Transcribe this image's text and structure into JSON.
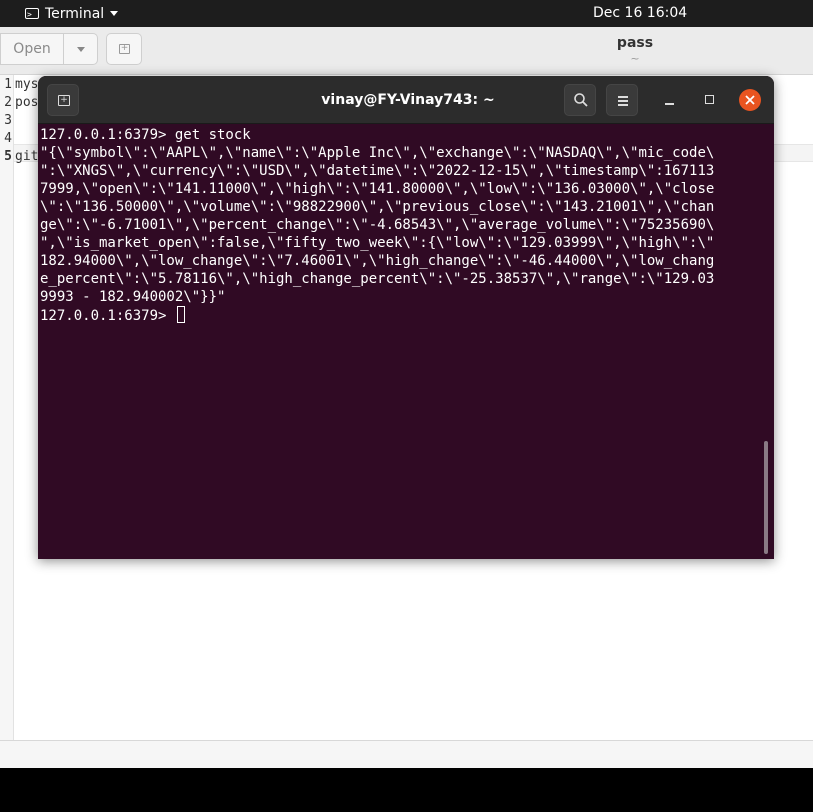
{
  "top_bar": {
    "app_name": "Terminal",
    "clock": "Dec 16  16:04"
  },
  "gedit": {
    "open_label": "Open",
    "title": "pass",
    "subtitle": "~",
    "line_numbers": [
      "1",
      "2",
      "3",
      "4",
      "5"
    ],
    "lines": [
      "mys",
      "pos",
      "",
      "",
      "git"
    ]
  },
  "terminal": {
    "title": "vinay@FY-Vinay743: ~",
    "lines": [
      "127.0.0.1:6379> get stock",
      "\"{\\\"symbol\\\":\\\"AAPL\\\",\\\"name\\\":\\\"Apple Inc\\\",\\\"exchange\\\":\\\"NASDAQ\\\",\\\"mic_code\\",
      "\":\\\"XNGS\\\",\\\"currency\\\":\\\"USD\\\",\\\"datetime\\\":\\\"2022-12-15\\\",\\\"timestamp\\\":167113",
      "7999,\\\"open\\\":\\\"141.11000\\\",\\\"high\\\":\\\"141.80000\\\",\\\"low\\\":\\\"136.03000\\\",\\\"close",
      "\\\":\\\"136.50000\\\",\\\"volume\\\":\\\"98822900\\\",\\\"previous_close\\\":\\\"143.21001\\\",\\\"chan",
      "ge\\\":\\\"-6.71001\\\",\\\"percent_change\\\":\\\"-4.68543\\\",\\\"average_volume\\\":\\\"75235690\\",
      "\",\\\"is_market_open\\\":false,\\\"fifty_two_week\\\":{\\\"low\\\":\\\"129.03999\\\",\\\"high\\\":\\\"",
      "182.94000\\\",\\\"low_change\\\":\\\"7.46001\\\",\\\"high_change\\\":\\\"-46.44000\\\",\\\"low_chang",
      "e_percent\\\":\\\"5.78116\\\",\\\"high_change_percent\\\":\\\"-25.38537\\\",\\\"range\\\":\\\"129.03",
      "9993 - 182.940002\\\"}}\""
    ],
    "prompt": "127.0.0.1:6379> "
  }
}
